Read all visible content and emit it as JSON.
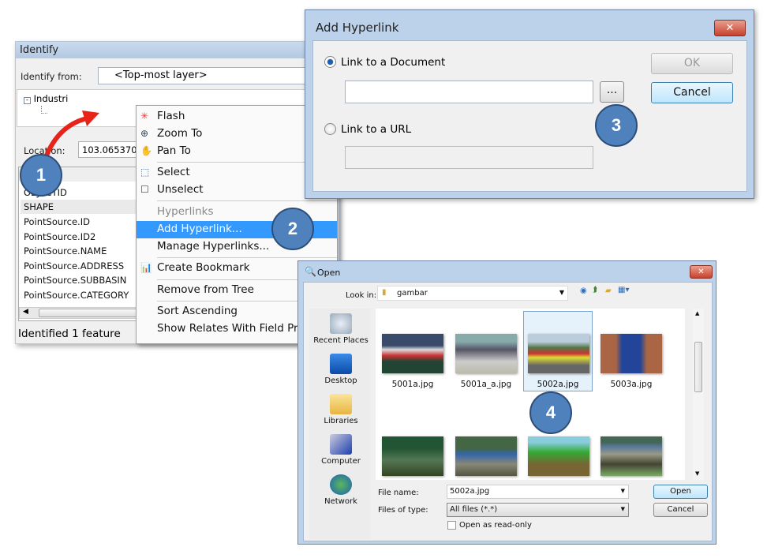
{
  "identify": {
    "title": "Identify",
    "identify_from_label": "Identify from:",
    "identify_from_value": "<Top-most layer>",
    "tree_root": "Industri",
    "location_label": "Location:",
    "location_value": "103.065370",
    "fields": [
      "OBJECTID",
      "SHAPE",
      "PointSource.ID",
      "PointSource.ID2",
      "PointSource.NAME",
      "PointSource.ADDRESS",
      "PointSource.SUBBASIN",
      "PointSource.CATEGORY"
    ],
    "status": "Identified 1 feature"
  },
  "context_menu": {
    "items": [
      {
        "label": "Flash",
        "icon": "flash-icon"
      },
      {
        "label": "Zoom To",
        "icon": "zoom-in-icon"
      },
      {
        "label": "Pan To",
        "icon": "pan-hand-icon"
      },
      {
        "label": "Select",
        "icon": "select-icon"
      },
      {
        "label": "Unselect",
        "icon": "unselect-icon"
      },
      {
        "label": "Hyperlinks",
        "disabled": true
      },
      {
        "label": "Add Hyperlink...",
        "highlighted": true
      },
      {
        "label": "Manage Hyperlinks..."
      },
      {
        "label": "Create Bookmark",
        "icon": "bookmark-icon"
      },
      {
        "label": "Remove from Tree"
      },
      {
        "label": "Sort Ascending"
      },
      {
        "label": "Show Relates With Field Prop"
      }
    ]
  },
  "add_hyperlink": {
    "title": "Add Hyperlink",
    "close": "✕",
    "link_document_label": "Link to a Document",
    "link_document_selected": true,
    "document_value": "",
    "browse_label": "...",
    "link_url_label": "Link to a URL",
    "url_value": "",
    "ok_label": "OK",
    "cancel_label": "Cancel"
  },
  "open_dialog": {
    "title": "Open",
    "close": "✕",
    "look_in_label": "Look in:",
    "look_in_value": "gambar",
    "places": [
      "Recent Places",
      "Desktop",
      "Libraries",
      "Computer",
      "Network"
    ],
    "files": [
      {
        "name": "5001a.jpg"
      },
      {
        "name": "5001a_a.jpg"
      },
      {
        "name": "5002a.jpg",
        "selected": true
      },
      {
        "name": "5003a.jpg"
      },
      {
        "name": ""
      },
      {
        "name": ""
      },
      {
        "name": ""
      },
      {
        "name": ""
      }
    ],
    "file_name_label": "File name:",
    "file_name_value": "5002a.jpg",
    "files_of_type_label": "Files of type:",
    "files_of_type_value": "All files (*.*)",
    "read_only_label": "Open as read-only",
    "open_label": "Open",
    "cancel_label": "Cancel"
  },
  "steps": [
    "1",
    "2",
    "3",
    "4"
  ],
  "colors": {
    "step_circle": "#4f81bd",
    "highlight": "#3399ff",
    "arrow": "#e8231a"
  }
}
